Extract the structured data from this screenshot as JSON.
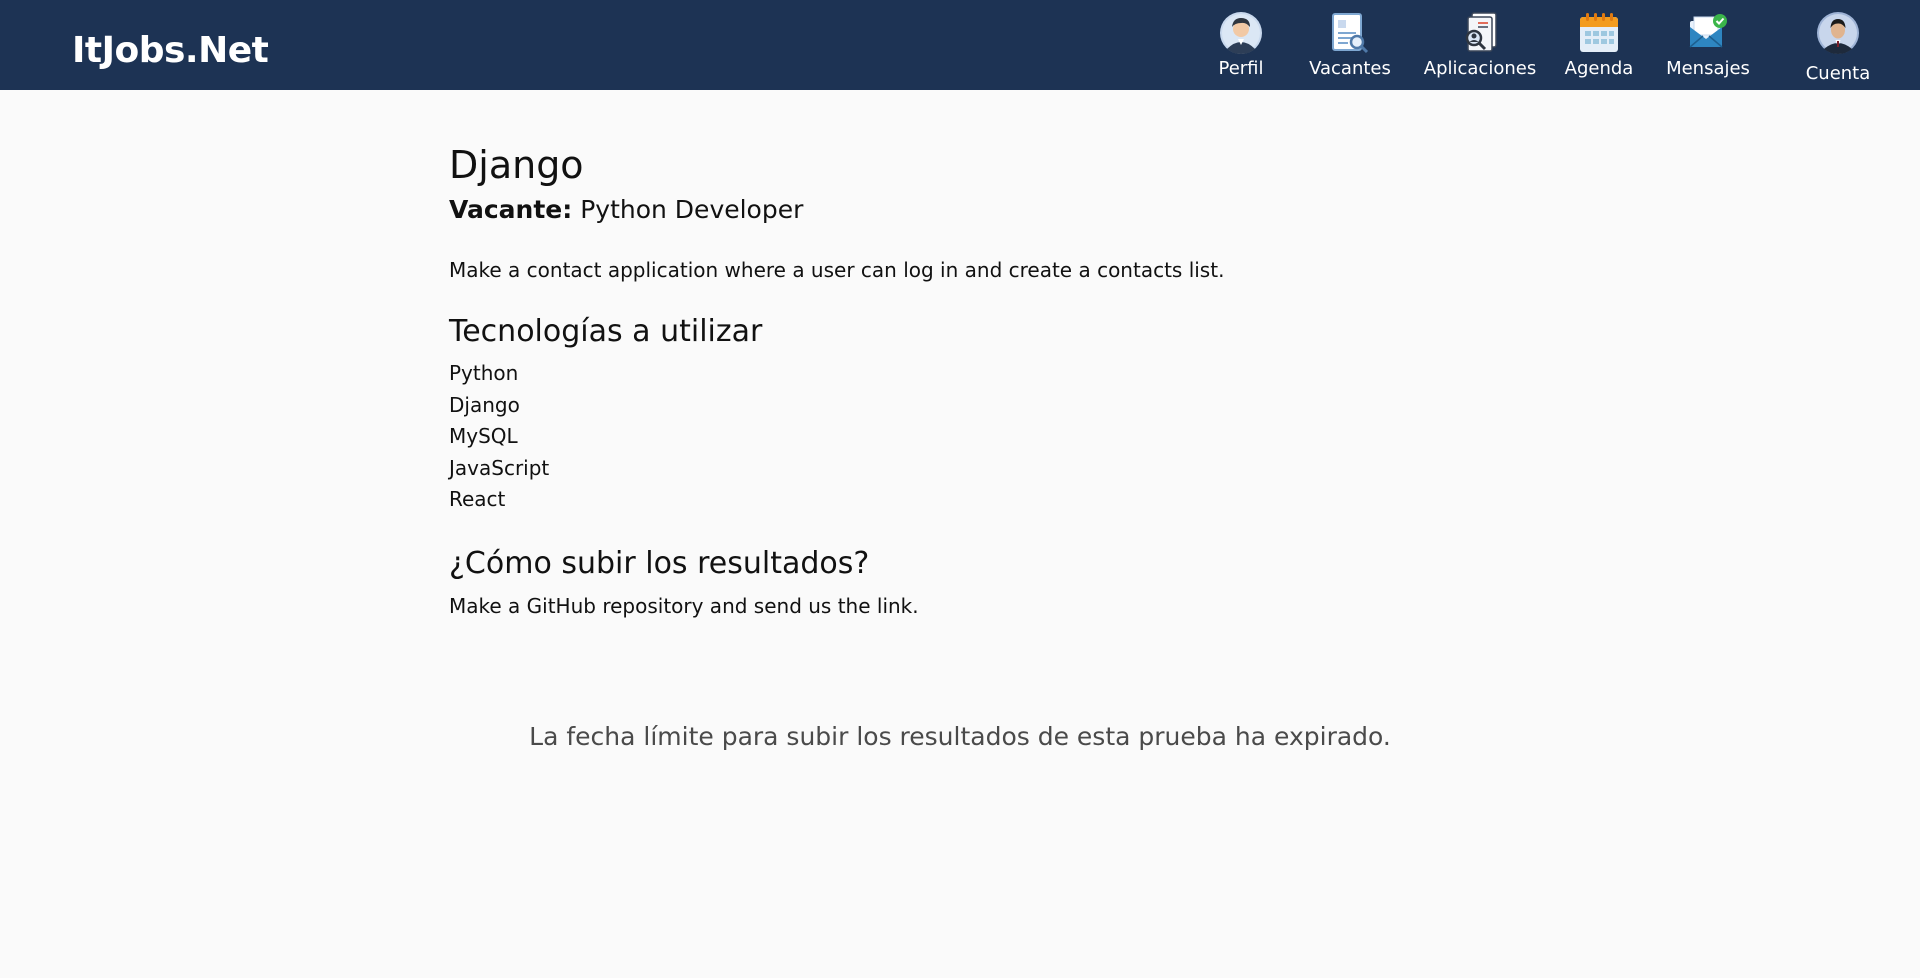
{
  "header": {
    "brand": "ItJobs.Net",
    "nav": [
      {
        "label": "Perfil",
        "icon": "profile-icon"
      },
      {
        "label": "Vacantes",
        "icon": "job-search-icon"
      },
      {
        "label": "Aplicaciones",
        "icon": "applications-icon"
      },
      {
        "label": "Agenda",
        "icon": "calendar-icon"
      },
      {
        "label": "Mensajes",
        "icon": "messages-icon"
      }
    ],
    "account": {
      "label": "Cuenta",
      "icon": "account-avatar-icon"
    },
    "colors": {
      "navbar": "#1d3354",
      "text": "#ffffff"
    }
  },
  "test": {
    "title": "Django",
    "vacancy_label": "Vacante:",
    "vacancy_value": "Python Developer",
    "description": "Make a contact application where a user can log in and create a contacts list.",
    "tech_heading": "Tecnologías a utilizar",
    "technologies": [
      "Python",
      "Django",
      "MySQL",
      "JavaScript",
      "React"
    ],
    "upload_heading": "¿Cómo subir los resultados?",
    "upload_text": "Make a GitHub repository and send us the link.",
    "expired_message": "La fecha límite para subir los resultados de esta prueba ha expirado."
  }
}
